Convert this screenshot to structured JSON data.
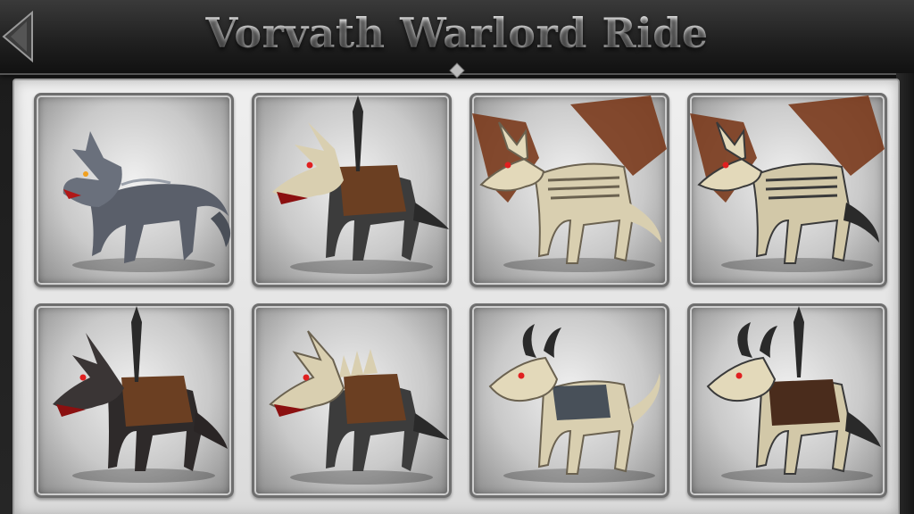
{
  "header": {
    "title": "Vorvath Warlord Ride",
    "back_icon": "back-arrow-icon"
  },
  "mounts": [
    {
      "name": "gray-wolf",
      "icon": "gray-wolf-icon"
    },
    {
      "name": "armored-bone-hound",
      "icon": "armored-bone-hound-icon"
    },
    {
      "name": "skeletal-dragon",
      "icon": "skeletal-dragon-icon"
    },
    {
      "name": "skeletal-dragon-variant",
      "icon": "skeletal-dragon-icon"
    },
    {
      "name": "armored-dark-wolf",
      "icon": "armored-dark-wolf-icon"
    },
    {
      "name": "spiked-bone-hound",
      "icon": "spiked-bone-hound-icon"
    },
    {
      "name": "horned-bone-beast",
      "icon": "horned-bone-beast-icon"
    },
    {
      "name": "armored-horned-bone-beast",
      "icon": "armored-horned-bone-beast-icon"
    }
  ],
  "colors": {
    "panel": "#e6e6e6",
    "frame": "#6e6e6e",
    "header": "#1f1f1f",
    "title": "#d6d6d6",
    "bone": "#d9cfb0",
    "leather": "#6b3f22",
    "eyes": "#e02020",
    "wing": "#7a3a1c"
  }
}
